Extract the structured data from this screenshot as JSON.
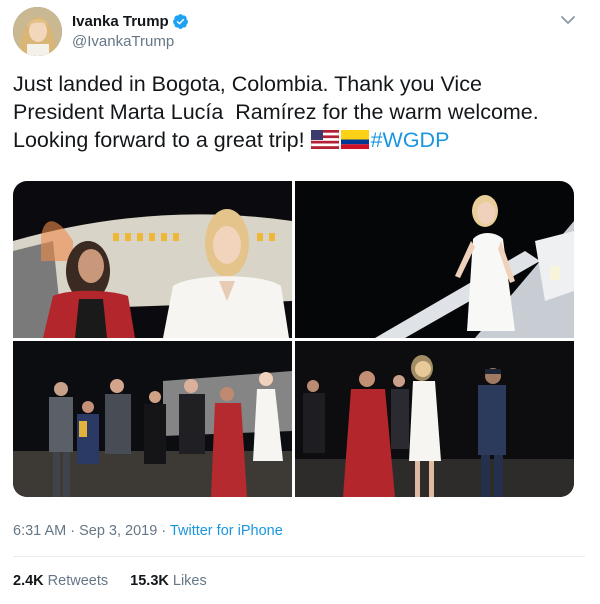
{
  "author": {
    "display_name": "Ivanka Trump",
    "handle": "@IvankaTrump",
    "verified": true,
    "avatar_icon": "profile-avatar"
  },
  "tweet": {
    "text_line1": "Just landed in Bogota, Colombia. Thank you Vice",
    "text_line2": "President Marta Lucía  Ramírez for the warm welcome.",
    "text_line3": "Looking forward to a great trip! ",
    "flags": [
      "us-flag-emoji",
      "colombia-flag-emoji"
    ],
    "hashtag": "#WGDP"
  },
  "media": {
    "photos": [
      "photo-arrival-tarmac-greeting",
      "photo-descending-aircraft-stairs",
      "photo-welcome-delegation-group",
      "photo-walking-with-officials"
    ]
  },
  "meta": {
    "time": "6:31 AM",
    "separator": " · ",
    "date": "Sep 3, 2019",
    "source": "Twitter for iPhone"
  },
  "stats": {
    "retweets_count": "2.4K",
    "retweets_label": " Retweets",
    "likes_count": "15.3K",
    "likes_label": " Likes"
  },
  "colors": {
    "link_blue": "#1b95e0",
    "text_primary": "#14171a",
    "text_secondary": "#657786",
    "verified_blue": "#1da1f2",
    "divider": "#e6ecf0"
  }
}
